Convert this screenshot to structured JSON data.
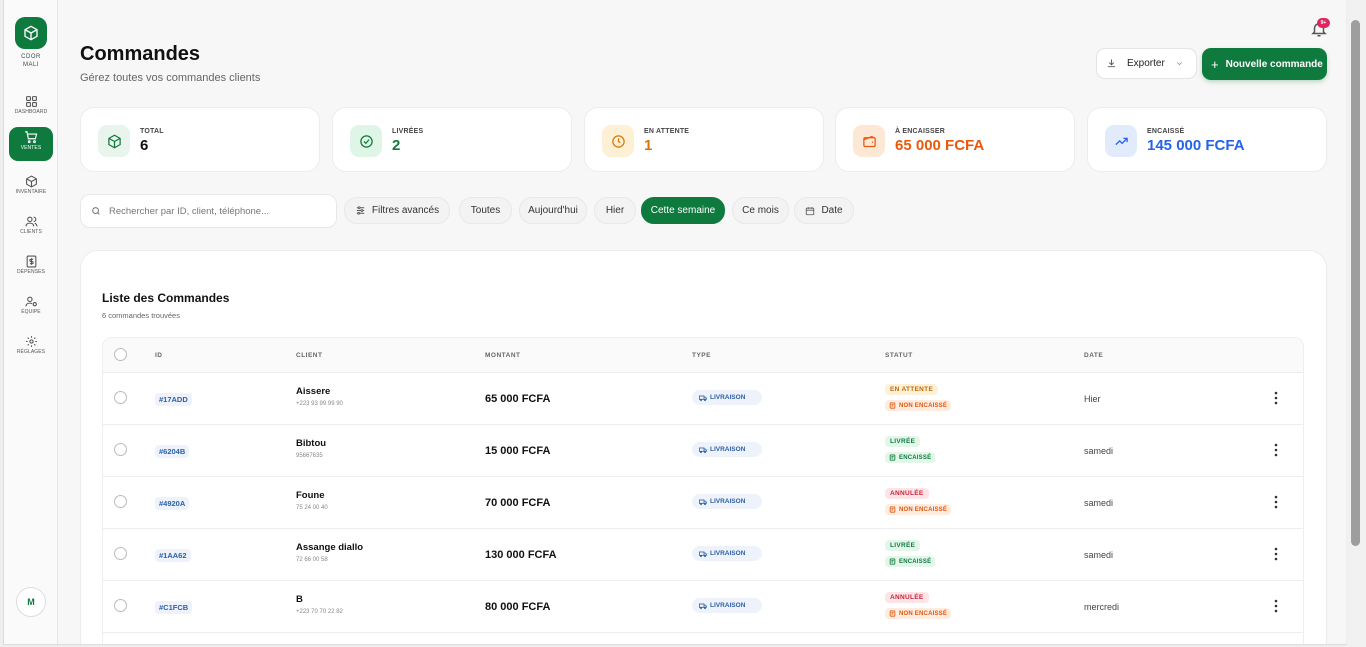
{
  "brand": {
    "line1": "CDOR",
    "line2": "MALI"
  },
  "sidebar": {
    "items": [
      {
        "label": "DASHBOARD",
        "icon": "grid-icon"
      },
      {
        "label": "VENTES",
        "icon": "cart-icon",
        "active": true
      },
      {
        "label": "INVENTAIRE",
        "icon": "box-icon"
      },
      {
        "label": "CLIENTS",
        "icon": "users-icon"
      },
      {
        "label": "DÉPENSES",
        "icon": "dollar-icon"
      },
      {
        "label": "ÉQUIPE",
        "icon": "team-icon"
      },
      {
        "label": "RÉGLAGES",
        "icon": "gear-icon"
      }
    ],
    "avatar": "M"
  },
  "header": {
    "title": "Commandes",
    "subtitle": "Gérez toutes vos commandes clients",
    "notif_badge": "9+",
    "export_label": "Exporter",
    "new_label": "Nouvelle commande"
  },
  "stats": [
    {
      "label": "TOTAL",
      "value": "6",
      "color": "#111111"
    },
    {
      "label": "LIVRÉES",
      "value": "2",
      "color": "#0f7a3e"
    },
    {
      "label": "EN ATTENTE",
      "value": "1",
      "color": "#d97706"
    },
    {
      "label": "À ENCAISSER",
      "value": "65 000 FCFA",
      "color": "#ea580c"
    },
    {
      "label": "ENCAISSÉ",
      "value": "145 000 FCFA",
      "color": "#2563eb"
    }
  ],
  "filters": {
    "search_placeholder": "Rechercher par ID, client, téléphone...",
    "advanced": "Filtres avancés",
    "chips": [
      "Toutes",
      "Aujourd'hui",
      "Hier",
      "Cette semaine",
      "Ce mois"
    ],
    "active_chip": "Cette semaine",
    "date": "Date"
  },
  "orders": {
    "title": "Liste des Commandes",
    "count": "6 commandes trouvées",
    "columns": [
      "ID",
      "CLIENT",
      "MONTANT",
      "TYPE",
      "STATUT",
      "DATE"
    ],
    "rows": [
      {
        "id": "#17ADD",
        "client": "Aissere",
        "phone": "+223 93 99 99 90",
        "amount": "65 000 FCFA",
        "type": "LIVRAISON",
        "status": "EN ATTENTE",
        "status_kind": "pending",
        "payment": "NON ENCAISSÉ",
        "payment_kind": "unpaid",
        "date": "Hier"
      },
      {
        "id": "#6204B",
        "client": "Bibtou",
        "phone": "95667635",
        "amount": "15 000 FCFA",
        "type": "LIVRAISON",
        "status": "LIVRÉE",
        "status_kind": "delivered",
        "payment": "ENCAISSÉ",
        "payment_kind": "paid",
        "date": "samedi"
      },
      {
        "id": "#4920A",
        "client": "Foune",
        "phone": "75 24 00 40",
        "amount": "70 000 FCFA",
        "type": "LIVRAISON",
        "status": "ANNULÉE",
        "status_kind": "cancelled",
        "payment": "NON ENCAISSÉ",
        "payment_kind": "unpaid",
        "date": "samedi"
      },
      {
        "id": "#1AA62",
        "client": "Assange diallo",
        "phone": "72 66 00 58",
        "amount": "130 000 FCFA",
        "type": "LIVRAISON",
        "status": "LIVRÉE",
        "status_kind": "delivered",
        "payment": "ENCAISSÉ",
        "payment_kind": "paid",
        "date": "samedi"
      },
      {
        "id": "#C1FCB",
        "client": "B",
        "phone": "+223 70 70 22 82",
        "amount": "80 000 FCFA",
        "type": "LIVRAISON",
        "status": "ANNULÉE",
        "status_kind": "cancelled",
        "payment": "NON ENCAISSÉ",
        "payment_kind": "unpaid",
        "date": "mercredi"
      }
    ]
  }
}
